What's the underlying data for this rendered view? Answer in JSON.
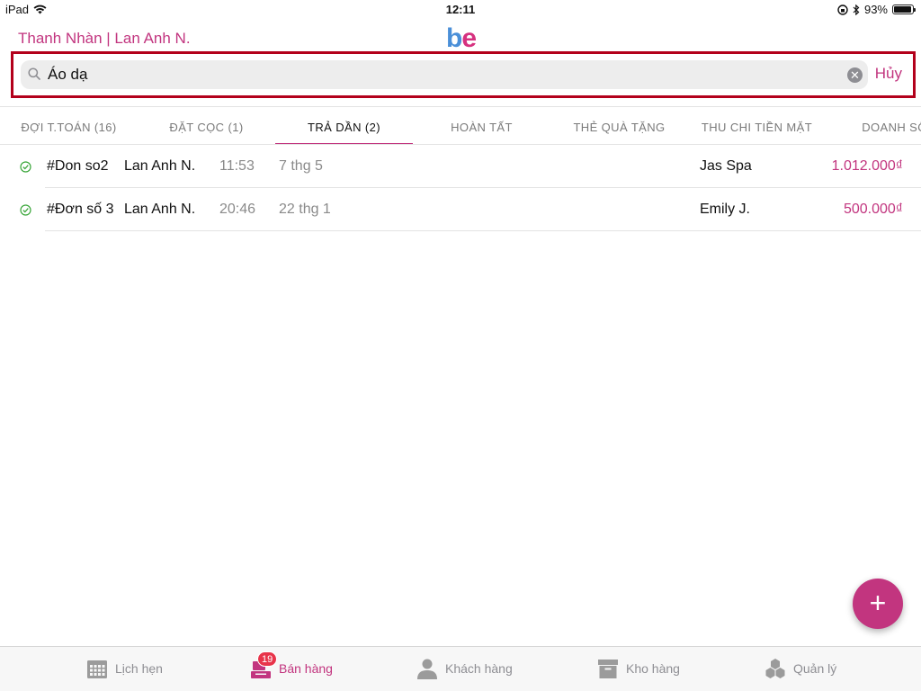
{
  "status_bar": {
    "device": "iPad",
    "time": "12:11",
    "battery": "93%",
    "battery_level": 0.93
  },
  "header": {
    "user_label": "Thanh Nhàn | Lan Anh N.",
    "logo_b": "b",
    "logo_e": "e"
  },
  "search": {
    "value": "Áo dạ",
    "cancel_label": "Hủy"
  },
  "tabs": [
    {
      "label": "ĐỢI T.TOÁN (16)",
      "active": false
    },
    {
      "label": "ĐẶT CỌC (1)",
      "active": false
    },
    {
      "label": "TRẢ DẦN (2)",
      "active": true
    },
    {
      "label": "HOÀN TẤT",
      "active": false
    },
    {
      "label": "THẺ QUÀ TẶNG",
      "active": false
    },
    {
      "label": "THU CHI TIỀN MẶT",
      "active": false
    },
    {
      "label": "DOANH SỐ",
      "active": false
    }
  ],
  "orders": [
    {
      "code": "#Don so2",
      "staff": "Lan Anh N.",
      "time": "11:53",
      "date": "7 thg 5",
      "customer": "Jas Spa",
      "amount": "1.012.000₫"
    },
    {
      "code": "#Đơn số 3",
      "staff": "Lan Anh N.",
      "time": "20:46",
      "date": "22 thg 1",
      "customer": "Emily J.",
      "amount": "500.000₫"
    }
  ],
  "fab": {
    "label": "+"
  },
  "tab_bar": [
    {
      "label": "Lịch hẹn",
      "icon": "calendar-icon",
      "active": false
    },
    {
      "label": "Bán hàng",
      "icon": "register-icon",
      "active": true,
      "badge": "19"
    },
    {
      "label": "Khách hàng",
      "icon": "person-icon",
      "active": false
    },
    {
      "label": "Kho hàng",
      "icon": "box-icon",
      "active": false
    },
    {
      "label": "Quản lý",
      "icon": "hexagons-icon",
      "active": false
    }
  ],
  "colors": {
    "accent": "#c2357f",
    "logo_blue": "#4a8fd8",
    "highlight_border": "#b3001b",
    "badge": "#e8344a",
    "check": "#3aa63a"
  }
}
